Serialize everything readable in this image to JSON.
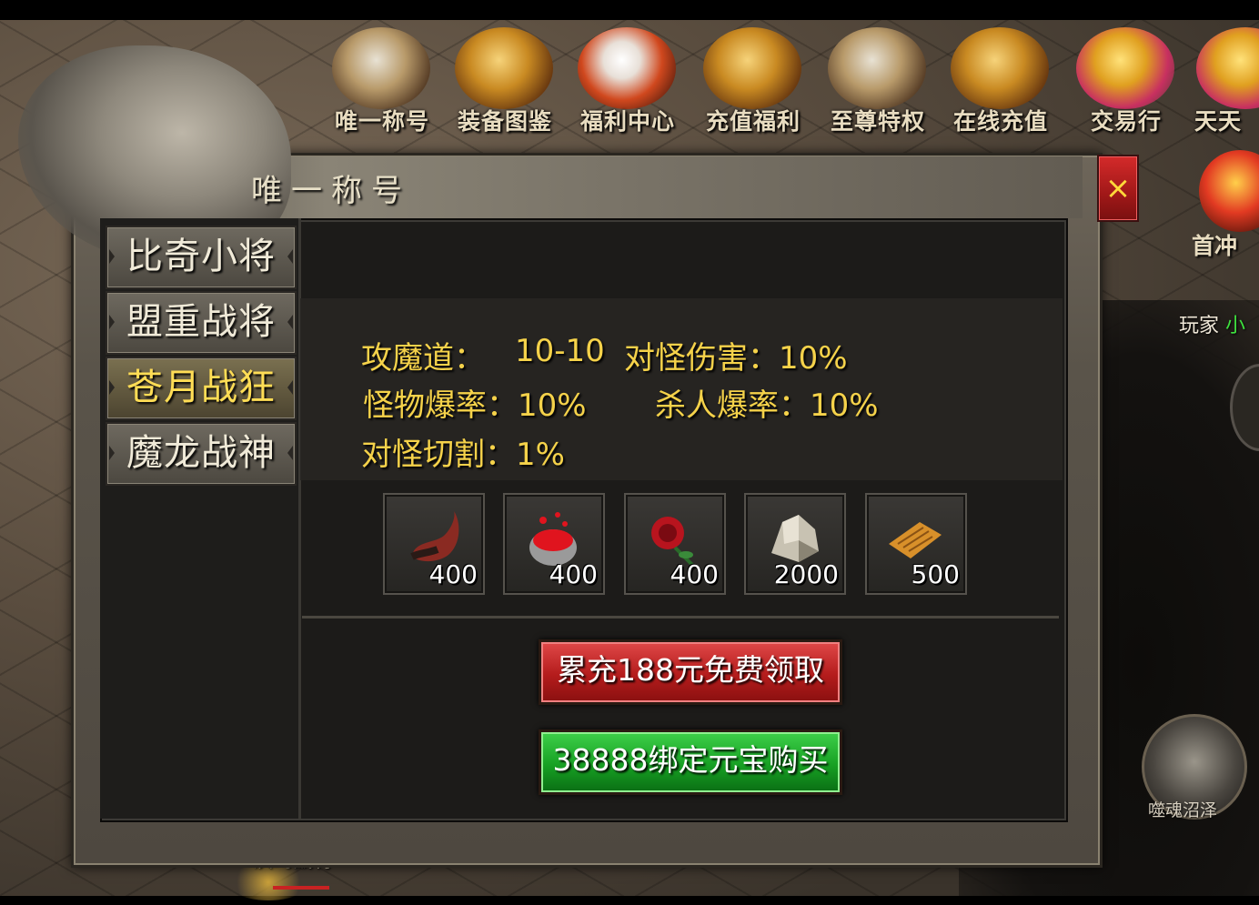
{
  "top_menu": [
    {
      "label": "唯一称号",
      "icon": "tiger-head-icon"
    },
    {
      "label": "装备图鉴",
      "icon": "golden-dragon-icon"
    },
    {
      "label": "福利中心",
      "icon": "dice-icon"
    },
    {
      "label": "充值福利",
      "icon": "golden-sword-icon"
    },
    {
      "label": "至尊特权",
      "icon": "crown-icon"
    },
    {
      "label": "在线充值",
      "icon": "money-bag-icon"
    },
    {
      "label": "交易行",
      "icon": "gold-ingot-icon"
    },
    {
      "label": "天天",
      "icon": "gift-icon"
    }
  ],
  "side_menu": {
    "label": "首冲",
    "icon": "first-recharge-icon"
  },
  "panel": {
    "title": "唯一称号",
    "close_symbol": "×",
    "tabs": [
      {
        "label": "比奇小将",
        "active": false
      },
      {
        "label": "盟重战将",
        "active": false
      },
      {
        "label": "苍月战狂",
        "active": true
      },
      {
        "label": "魔龙战神",
        "active": false
      }
    ],
    "stats": {
      "attack_label": "攻魔道：",
      "attack_value": "10-10",
      "monster_damage": "对怪伤害：10%",
      "monster_drop": "怪物爆率：10%",
      "pk_drop": "杀人爆率：10%",
      "monster_cut": "对怪切割：1%"
    },
    "items": [
      {
        "name": "horn-icon",
        "count": "400"
      },
      {
        "name": "blood-bowl-icon",
        "count": "400"
      },
      {
        "name": "rose-icon",
        "count": "400"
      },
      {
        "name": "ore-icon",
        "count": "2000"
      },
      {
        "name": "scroll-icon",
        "count": "500"
      }
    ],
    "buttons": {
      "recharge_claim": "累充188元免费领取",
      "buy_with_ingot": "38888绑定元宝购买"
    }
  },
  "hud": {
    "player_prefix": "玩家",
    "player_name": "小",
    "map_name": "噬魂沼泽",
    "under_text": "沃玛战将"
  },
  "colors": {
    "stat_text": "#f5d24a",
    "active_tab_text": "#ffdd55",
    "claim_button": "#b41c1c",
    "buy_button": "#17a023",
    "close_button": "#c02020"
  }
}
